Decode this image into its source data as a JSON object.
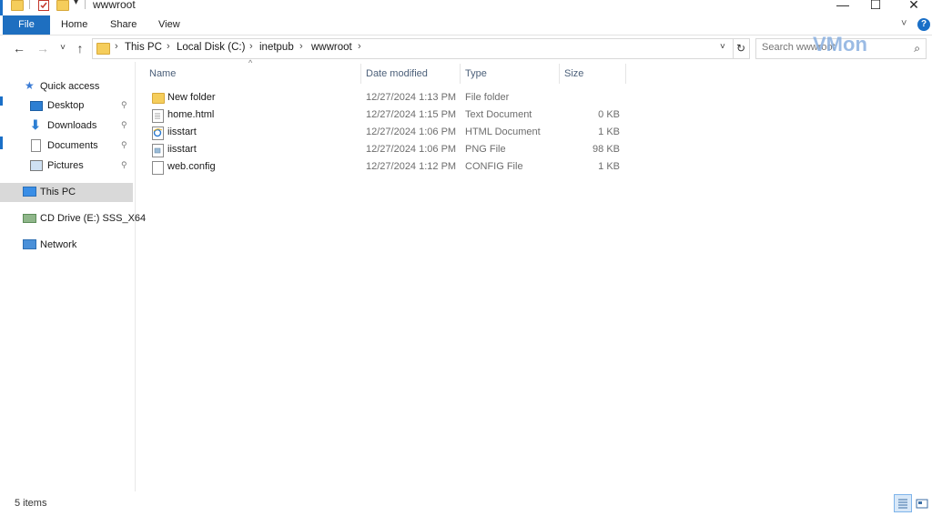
{
  "window": {
    "title": "wwwroot",
    "quick_access_toolbar": [
      "folder-icon",
      "properties-check-icon",
      "new-folder-icon",
      "customize-dropdown-icon"
    ],
    "controls": {
      "minimize": "—",
      "maximize": "☐",
      "close": "✕"
    }
  },
  "ribbon": {
    "tabs": [
      "File",
      "Home",
      "Share",
      "View"
    ],
    "expand_glyph": "˅",
    "help_glyph": "?"
  },
  "nav_buttons": {
    "back": "←",
    "forward": "→",
    "recent": "˅",
    "up": "↑"
  },
  "address": {
    "crumbs": [
      "This PC",
      "Local Disk (C:)",
      "inetpub",
      "wwwroot"
    ],
    "separator": "›",
    "dropdown": "˅",
    "refresh": "↻"
  },
  "search": {
    "placeholder": "Search wwwroot",
    "icon": "⌕"
  },
  "watermark": "VMon",
  "nav_pane": {
    "items": [
      {
        "label": "Quick access",
        "icon": "star-icon",
        "pinned": false
      },
      {
        "label": "Desktop",
        "icon": "desktop-icon",
        "pinned": true
      },
      {
        "label": "Downloads",
        "icon": "downloads-icon",
        "pinned": true
      },
      {
        "label": "Documents",
        "icon": "documents-icon",
        "pinned": true
      },
      {
        "label": "Pictures",
        "icon": "pictures-icon",
        "pinned": true
      },
      {
        "label": "This PC",
        "icon": "computer-icon",
        "pinned": false,
        "selected": true
      },
      {
        "label": "CD Drive (E:) SSS_X64",
        "icon": "cd-drive-icon",
        "pinned": false
      },
      {
        "label": "Network",
        "icon": "network-icon",
        "pinned": false
      }
    ],
    "pin_glyph": "📌"
  },
  "file_list": {
    "columns": {
      "name": "Name",
      "date": "Date modified",
      "type": "Type",
      "size": "Size"
    },
    "sort_glyph": "^",
    "rows": [
      {
        "name": "New folder",
        "date": "12/27/2024 1:13 PM",
        "type": "File folder",
        "size": "",
        "icon": "folder-icon"
      },
      {
        "name": "home.html",
        "date": "12/27/2024 1:15 PM",
        "type": "Text Document",
        "size": "0 KB",
        "icon": "text-file-icon"
      },
      {
        "name": "iisstart",
        "date": "12/27/2024 1:06 PM",
        "type": "HTML Document",
        "size": "1 KB",
        "icon": "ie-html-icon"
      },
      {
        "name": "iisstart",
        "date": "12/27/2024 1:06 PM",
        "type": "PNG File",
        "size": "98 KB",
        "icon": "png-file-icon"
      },
      {
        "name": "web.config",
        "date": "12/27/2024 1:12 PM",
        "type": "CONFIG File",
        "size": "1 KB",
        "icon": "config-file-icon"
      }
    ]
  },
  "status": {
    "text": "5 items"
  },
  "colors": {
    "accent": "#1e6fc0",
    "selected_nav": "#d9d9d9",
    "folder": "#f5cd5b",
    "header_text": "#4c607a"
  }
}
